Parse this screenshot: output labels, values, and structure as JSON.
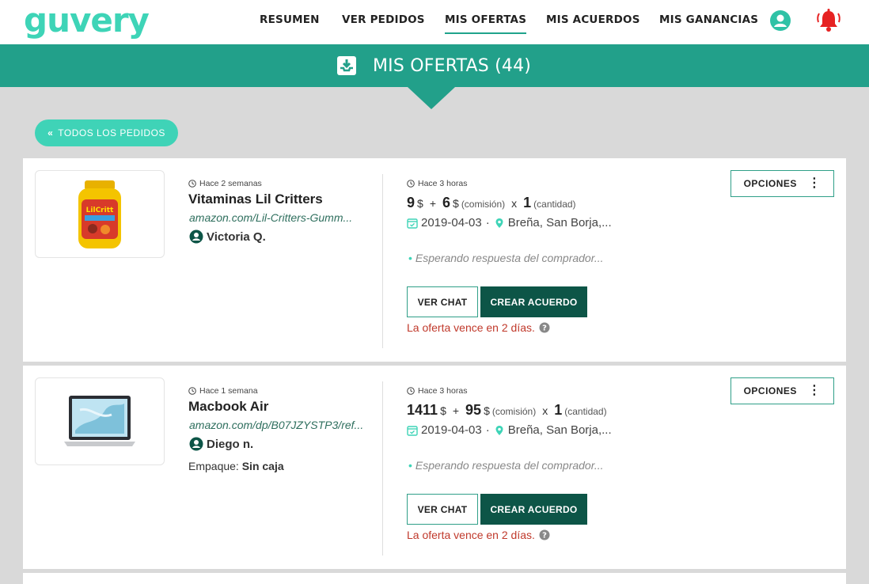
{
  "nav": {
    "logo": "guvery",
    "items": [
      "RESUMEN",
      "VER PEDIDOS",
      "MIS OFERTAS",
      "MIS ACUERDOS",
      "MIS GANANCIAS"
    ],
    "active": "MIS OFERTAS"
  },
  "banner": {
    "title": "MIS OFERTAS (44)"
  },
  "back_button": {
    "label": "TODOS LOS PEDIDOS"
  },
  "colors": {
    "brand": "#3ed4b7",
    "banner": "#22a08a",
    "dark_button": "#0d5547",
    "expiry": "#c0392b"
  },
  "offers": [
    {
      "request_time": "Hace 2 semanas",
      "title": "Vitaminas Lil Critters",
      "link": "amazon.com/Lil-Critters-Gumm...",
      "buyer": "Victoria Q.",
      "offer_time": "Hace 3 horas",
      "price": "9",
      "price_unit": "$",
      "plus": "+",
      "commission": "6",
      "commission_unit": "$",
      "commission_label": "(comisión)",
      "times": "x",
      "quantity": "1",
      "quantity_label": "(cantidad)",
      "date": "2019-04-03",
      "location": "Breña, San Borja,...",
      "status": "Esperando respuesta del comprador...",
      "chat_label": "VER CHAT",
      "deal_label": "CREAR ACUERDO",
      "expiry": "La oferta vence en 2 días.",
      "options_label": "OPCIONES"
    },
    {
      "request_time": "Hace 1 semana",
      "title": "Macbook Air",
      "link": "amazon.com/dp/B07JZYSTP3/ref...",
      "buyer": "Diego n.",
      "packing_label": "Empaque:",
      "packing_value": "Sin caja",
      "offer_time": "Hace 3 horas",
      "price": "1411",
      "price_unit": "$",
      "plus": "+",
      "commission": "95",
      "commission_unit": "$",
      "commission_label": "(comisión)",
      "times": "x",
      "quantity": "1",
      "quantity_label": "(cantidad)",
      "date": "2019-04-03",
      "location": "Breña, San Borja,...",
      "status": "Esperando respuesta del comprador...",
      "chat_label": "VER CHAT",
      "deal_label": "CREAR ACUERDO",
      "expiry": "La oferta vence en 2 días.",
      "options_label": "OPCIONES"
    }
  ]
}
